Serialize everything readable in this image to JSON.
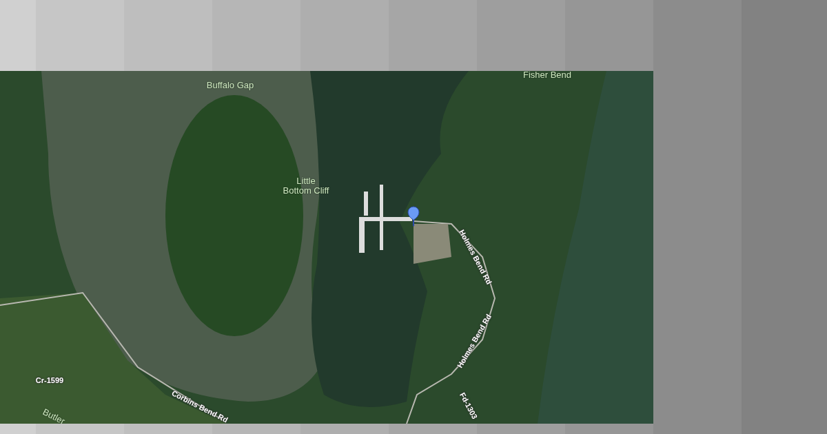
{
  "map": {
    "labels": [
      {
        "text": "Fisher Bend",
        "kind": "place"
      },
      {
        "text": "Buffalo Gap",
        "kind": "place"
      },
      {
        "text": "Little\nBottom Cliff",
        "kind": "place"
      },
      {
        "text": "Holmes Bend Rd",
        "kind": "road"
      },
      {
        "text": "Holmes Bend Rd",
        "kind": "road"
      },
      {
        "text": "Cr-1599",
        "kind": "road"
      },
      {
        "text": "Corbins Bend Rd",
        "kind": "road"
      },
      {
        "text": "Butler",
        "kind": "place"
      },
      {
        "text": "Fd-1303",
        "kind": "road"
      }
    ]
  }
}
